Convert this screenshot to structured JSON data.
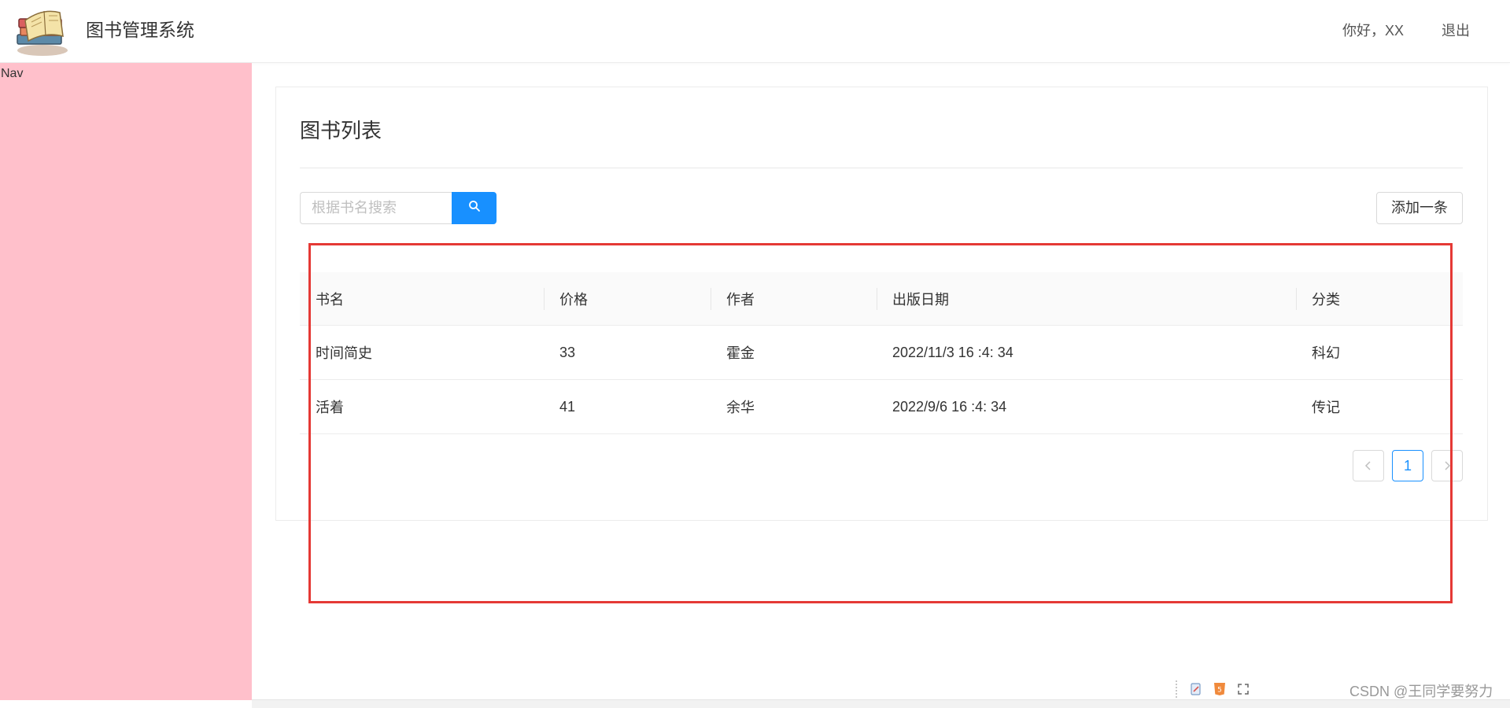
{
  "header": {
    "app_title": "图书管理系统",
    "greeting": "你好，XX",
    "logout_label": "退出",
    "logo_icon": "books-logo-icon"
  },
  "sidebar": {
    "label": "Nav",
    "background": "#ffc0cb"
  },
  "main": {
    "title": "图书列表",
    "search": {
      "placeholder": "根据书名搜索",
      "value": "",
      "button_icon": "search-icon"
    },
    "add_button_label": "添加一条",
    "table": {
      "columns": [
        "书名",
        "价格",
        "作者",
        "出版日期",
        "分类"
      ],
      "rows": [
        [
          "时间简史",
          "33",
          "霍金",
          "2022/11/3 16 :4: 34",
          "科幻"
        ],
        [
          "活着",
          "41",
          "余华",
          "2022/9/6 16 :4: 34",
          "传记"
        ]
      ]
    },
    "pagination": {
      "prev_icon": "chevron-left-icon",
      "current_page": "1",
      "next_icon": "chevron-right-icon"
    }
  },
  "watermark": "CSDN @王同学要努力",
  "colors": {
    "primary": "#1890ff",
    "annotation": "#e53935"
  }
}
